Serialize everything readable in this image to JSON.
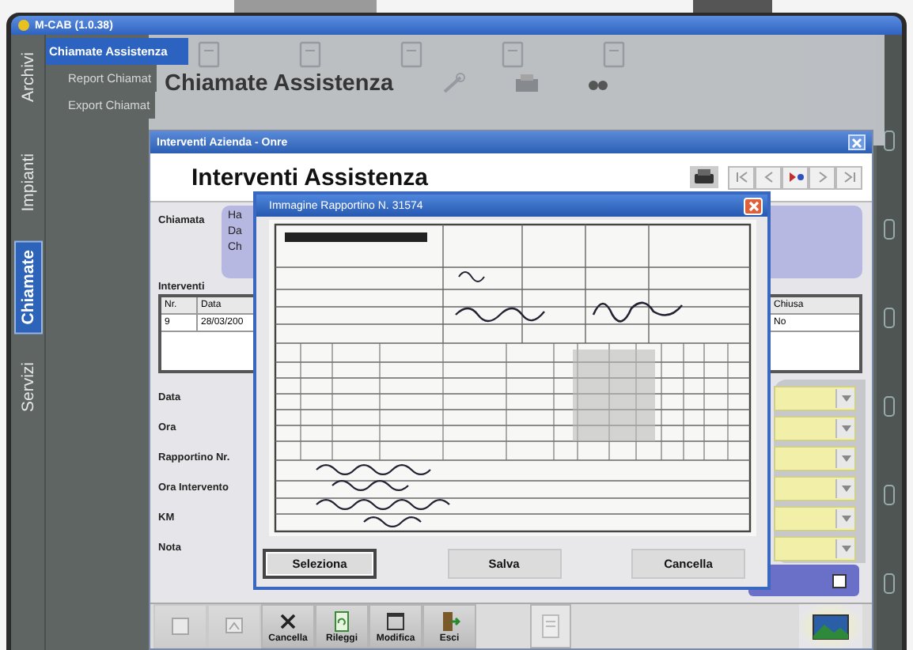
{
  "window": {
    "title": "M-CAB (1.0.38)"
  },
  "side_tabs": [
    {
      "label": "Archivi",
      "selected": false
    },
    {
      "label": "Impianti",
      "selected": false
    },
    {
      "label": "Chiamate",
      "selected": true
    },
    {
      "label": "Servizi",
      "selected": false
    }
  ],
  "side_menu": [
    {
      "label": "Chiamate Assistenza",
      "selected": true
    },
    {
      "label": "Report Chiamat",
      "selected": false
    },
    {
      "label": "Export Chiamat",
      "selected": false
    }
  ],
  "background_window": {
    "heading": "Chiamate Assistenza"
  },
  "main_window": {
    "title": "Interventi Azienda - Onre",
    "heading": "Interventi Assistenza",
    "chiamata": {
      "label": "Chiamata",
      "lines": [
        "Ha",
        "Da",
        "Ch"
      ]
    },
    "interventi": {
      "label": "Interventi",
      "columns": [
        "Nr.",
        "Data",
        "Chiusa"
      ],
      "rows": [
        [
          "9",
          "28/03/200",
          "No"
        ]
      ]
    },
    "fields": [
      {
        "label": "Data"
      },
      {
        "label": "Ora"
      },
      {
        "label": "Rapportino Nr."
      },
      {
        "label": "Ora Intervento"
      },
      {
        "label": "KM"
      },
      {
        "label": "Nota"
      }
    ],
    "confirm_checkbox": {
      "checked": false
    },
    "toolbar": [
      {
        "kind": "save",
        "disabled": true
      },
      {
        "kind": "restore",
        "disabled": true
      },
      {
        "kind": "delete",
        "label": "Cancella",
        "disabled": false
      },
      {
        "kind": "reload",
        "label": "Rileggi",
        "disabled": false
      },
      {
        "kind": "edit",
        "label": "Modifica",
        "disabled": false
      },
      {
        "kind": "exit",
        "label": "Esci",
        "disabled": false
      },
      {
        "kind": "document",
        "disabled": false
      },
      {
        "kind": "image",
        "disabled": false
      }
    ]
  },
  "image_dialog": {
    "title": "Immagine Rapportino N. 31574",
    "buttons": [
      {
        "label": "Seleziona",
        "focused": true
      },
      {
        "label": "Salva",
        "focused": false
      },
      {
        "label": "Cancella",
        "focused": false
      }
    ]
  }
}
